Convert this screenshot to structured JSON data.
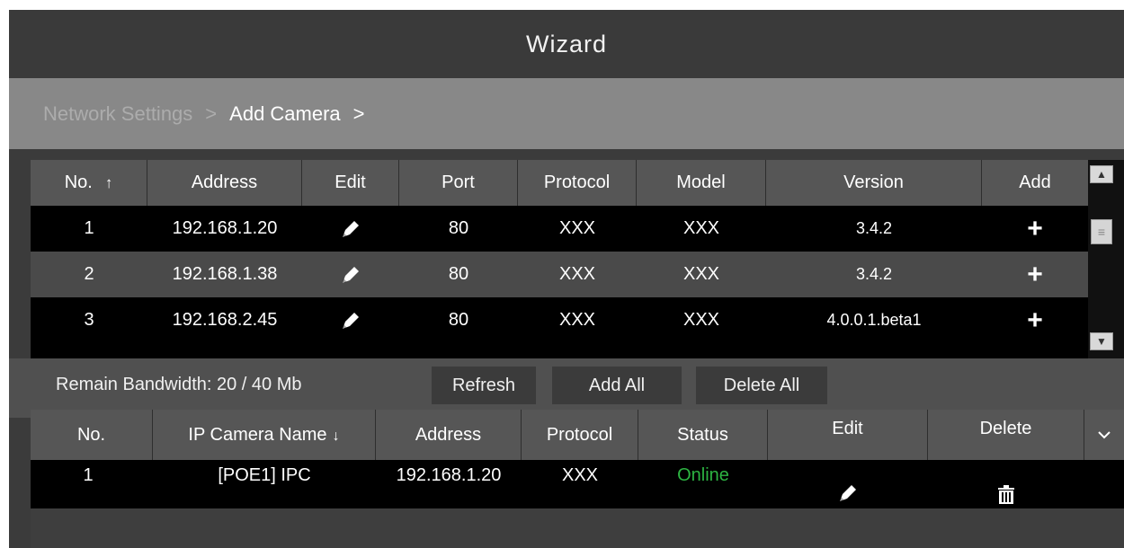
{
  "window": {
    "title": "Wizard"
  },
  "breadcrumb": {
    "items": [
      "Network Settings",
      "Add Camera"
    ],
    "separator": ">"
  },
  "search_table": {
    "columns": {
      "no": "No.",
      "address": "Address",
      "edit": "Edit",
      "port": "Port",
      "protocol": "Protocol",
      "model": "Model",
      "version": "Version",
      "add": "Add"
    },
    "rows": [
      {
        "no": "1",
        "address": "192.168.1.20",
        "port": "80",
        "protocol": "XXX",
        "model": "XXX",
        "version": "3.4.2"
      },
      {
        "no": "2",
        "address": "192.168.1.38",
        "port": "80",
        "protocol": "XXX",
        "model": "XXX",
        "version": "3.4.2"
      },
      {
        "no": "3",
        "address": "192.168.2.45",
        "port": "80",
        "protocol": "XXX",
        "model": "XXX",
        "version": "4.0.0.1.beta1"
      }
    ]
  },
  "toolbar": {
    "bandwidth": "Remain Bandwidth: 20 / 40 Mb",
    "refresh": "Refresh",
    "add_all": "Add All",
    "delete_all": "Delete All"
  },
  "added_table": {
    "columns": {
      "no": "No.",
      "name": "IP Camera Name",
      "address": "Address",
      "protocol": "Protocol",
      "status": "Status",
      "edit": "Edit",
      "delete": "Delete"
    },
    "rows": [
      {
        "no": "1",
        "name": "[POE1] IPC",
        "address": "192.168.1.20",
        "protocol": "XXX",
        "status": "Online"
      }
    ]
  },
  "colors": {
    "online": "#2db442",
    "header": "#565656",
    "breadcrumb_bar": "#888888"
  }
}
